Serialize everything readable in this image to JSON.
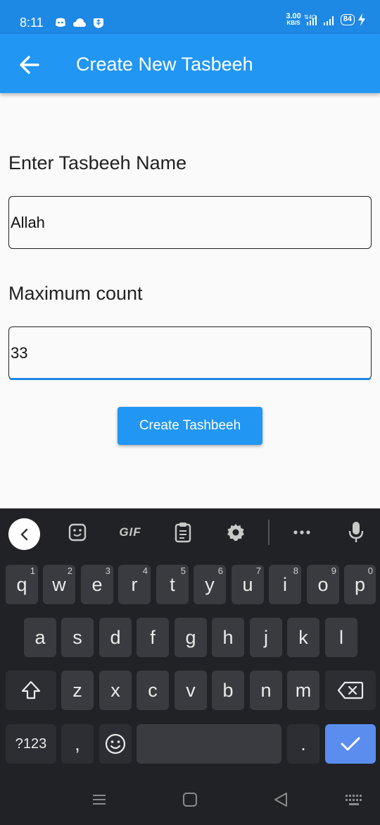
{
  "status_bar": {
    "time": "8:11",
    "net_speed_value": "3.00",
    "net_speed_unit": "KB/S",
    "battery": "84",
    "icons": [
      "discord-icon",
      "cloud-icon",
      "usb-icon",
      "lte-icon",
      "signal-icon",
      "signal-icon-2",
      "charging-icon"
    ]
  },
  "app_bar": {
    "title": "Create New Tasbeeh",
    "back_icon": "arrow-left-icon",
    "color": "#2196f3"
  },
  "form": {
    "name_label": "Enter Tasbeeh Name",
    "name_value": "Allah",
    "count_label": "Maximum count",
    "count_value": "33",
    "submit_label": "Create Tashbeeh"
  },
  "keyboard": {
    "toolbar": [
      "chevron-left-icon",
      "sticker-icon",
      "GIF",
      "clipboard-icon",
      "gear-icon",
      "more-icon",
      "mic-icon"
    ],
    "gif_label": "GIF",
    "row1": [
      {
        "k": "q",
        "h": "1"
      },
      {
        "k": "w",
        "h": "2"
      },
      {
        "k": "e",
        "h": "3"
      },
      {
        "k": "r",
        "h": "4"
      },
      {
        "k": "t",
        "h": "5"
      },
      {
        "k": "y",
        "h": "6"
      },
      {
        "k": "u",
        "h": "7"
      },
      {
        "k": "i",
        "h": "8"
      },
      {
        "k": "o",
        "h": "9"
      },
      {
        "k": "p",
        "h": "0"
      }
    ],
    "row2": [
      "a",
      "s",
      "d",
      "f",
      "g",
      "h",
      "j",
      "k",
      "l"
    ],
    "row3": [
      "z",
      "x",
      "c",
      "v",
      "b",
      "n",
      "m"
    ],
    "symbols_label": "?123",
    "comma": ",",
    "period": ".",
    "accent_color": "#5b8def"
  },
  "nav_bar": {
    "icons": [
      "recents-icon",
      "home-icon",
      "back-icon",
      "keyboard-switch-icon"
    ]
  }
}
